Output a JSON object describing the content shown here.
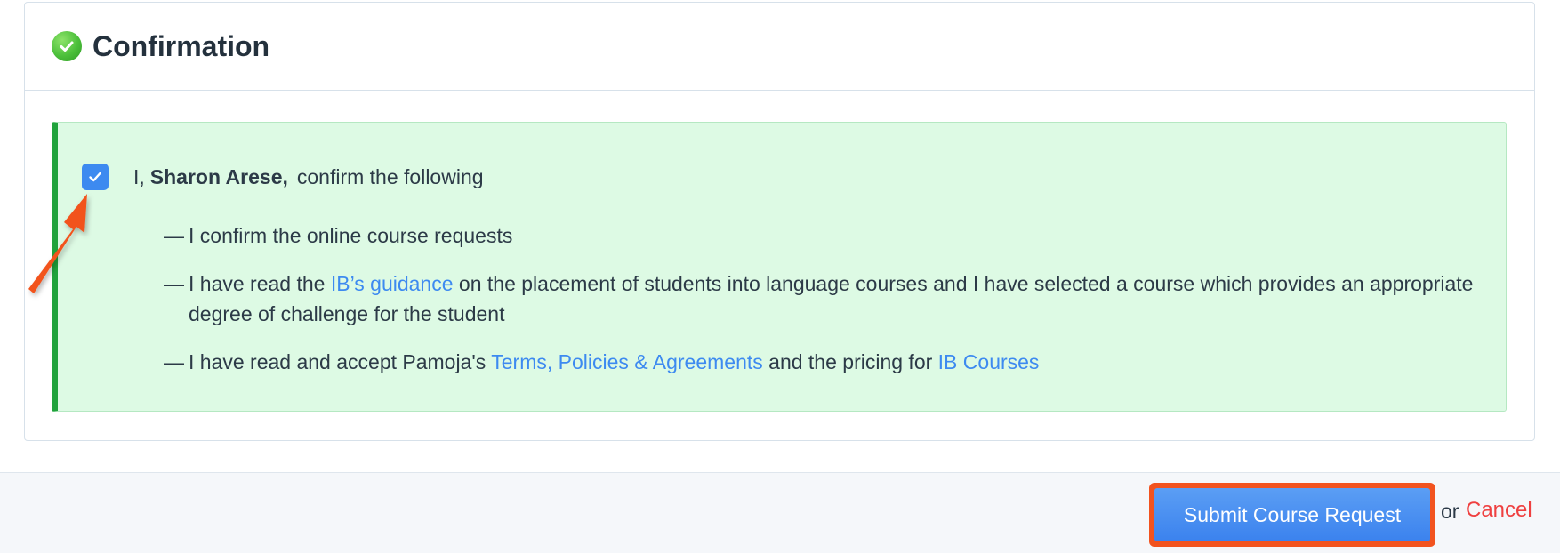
{
  "card": {
    "title": "Confirmation",
    "icon": "check-circle-icon",
    "icon_color": "#4bbf3a"
  },
  "notice": {
    "background": "#ddfae4",
    "accent": "#20a33c",
    "checkbox_checked": true,
    "prefix": "I,",
    "user_name": "Sharon Arese,",
    "suffix": "confirm the following",
    "items": [
      {
        "parts": [
          {
            "text": "I confirm the online course requests"
          }
        ]
      },
      {
        "parts": [
          {
            "text": "I have read the "
          },
          {
            "text": "IB’s guidance",
            "link": true
          },
          {
            "text": " on the placement of students into language courses and I have selected a course which provides an appropriate degree of challenge for the student"
          }
        ]
      },
      {
        "parts": [
          {
            "text": "I have read and accept Pamoja's "
          },
          {
            "text": "Terms, Policies & Agreements",
            "link": true
          },
          {
            "text": " and the pricing for "
          },
          {
            "text": "IB Courses",
            "link": true
          }
        ]
      }
    ],
    "dash": "—"
  },
  "footer": {
    "submit_label": "Submit Course Request",
    "or_text": "or",
    "cancel_label": "Cancel",
    "submit_color": "#3b82ee",
    "highlight_color": "#f2531f",
    "cancel_color": "#ef4040"
  },
  "annotation": {
    "arrow_icon": "annotation-arrow-icon",
    "arrow_color": "#f2531f"
  }
}
